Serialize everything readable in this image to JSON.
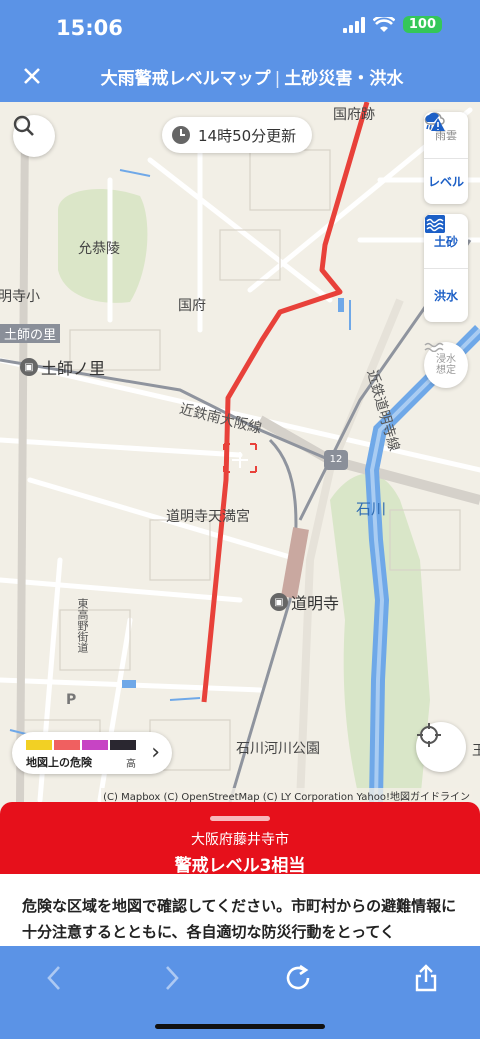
{
  "status": {
    "time": "15:06",
    "battery": "100"
  },
  "header": {
    "title": "大雨警戒レベルマップ",
    "subtitle": "土砂災害・洪水"
  },
  "map": {
    "updated": "14時50分更新",
    "labels": {
      "kokufu_ruins": "国府跡",
      "ingyo_tomb": "允恭陵",
      "domyoji_school": "明寺小",
      "haji_sato_station_area": "土師の里",
      "haji_no_sato_station": "土師ノ里",
      "kokufu": "国府",
      "kintetsu_minami_osaka": "近鉄南大阪線",
      "kintetsu_domyoji_line": "近鉄道明寺線",
      "route_number": "12",
      "ishikawa_river": "石川",
      "domyoji_tenmangu": "道明寺天満宮",
      "domyoji_station": "道明寺",
      "higashi_koya_kaido": "東高野街道",
      "parking": "P",
      "ishikawa_park": "石川河川公園",
      "edge_label": "王"
    },
    "layers": {
      "rain": "雨雲",
      "level": "レベル",
      "landslide": "土砂",
      "flood": "洪水",
      "inundation_line1": "浸水",
      "inundation_line2": "想定"
    },
    "legend": {
      "label": "地図上の危険",
      "high": "高",
      "colors": [
        "#f2d024",
        "#f06060",
        "#c744c4",
        "#2a2730"
      ]
    },
    "attribution": "(C) Mapbox (C) OpenStreetMap (C) LY Corporation Yahoo!地図ガイドライン"
  },
  "alert": {
    "city": "大阪府藤井寺市",
    "level": "警戒レベル3相当",
    "body": "危険な区域を地図で確認してください。市町村からの避難情報に十分注意するとともに、各自適切な防災行動をとってく"
  },
  "colors": {
    "header": "#5b93e6",
    "alert": "#e6101b",
    "warning_line": "#e8413a"
  }
}
